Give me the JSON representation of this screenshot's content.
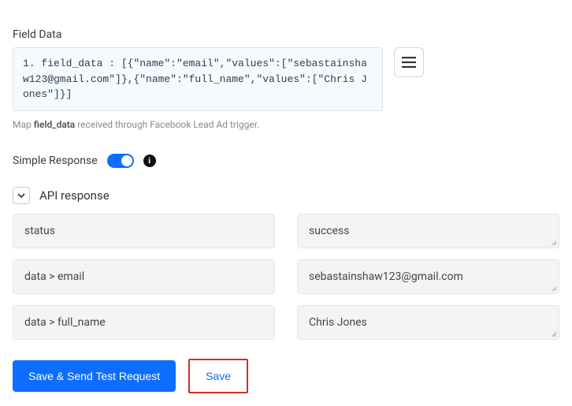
{
  "field_data": {
    "label": "Field Data",
    "content": "1. field_data : [{\"name\":\"email\",\"values\":[\"sebastainshaw123@gmail.com\"]},{\"name\":\"full_name\",\"values\":[\"Chris Jones\"]}]",
    "helper_prefix": "Map ",
    "helper_bold": "field_data",
    "helper_suffix": " received through Facebook Lead Ad trigger."
  },
  "simple_response": {
    "label": "Simple Response",
    "toggle_on": true
  },
  "api": {
    "label": "API response",
    "rows": [
      {
        "key": "status",
        "value": "success"
      },
      {
        "key": "data > email",
        "value": "sebastainshaw123@gmail.com"
      },
      {
        "key": "data > full_name",
        "value": "Chris Jones"
      }
    ]
  },
  "buttons": {
    "primary": "Save & Send Test Request",
    "secondary": "Save"
  },
  "colors": {
    "accent": "#0d6efd",
    "highlight": "#d92d20"
  }
}
